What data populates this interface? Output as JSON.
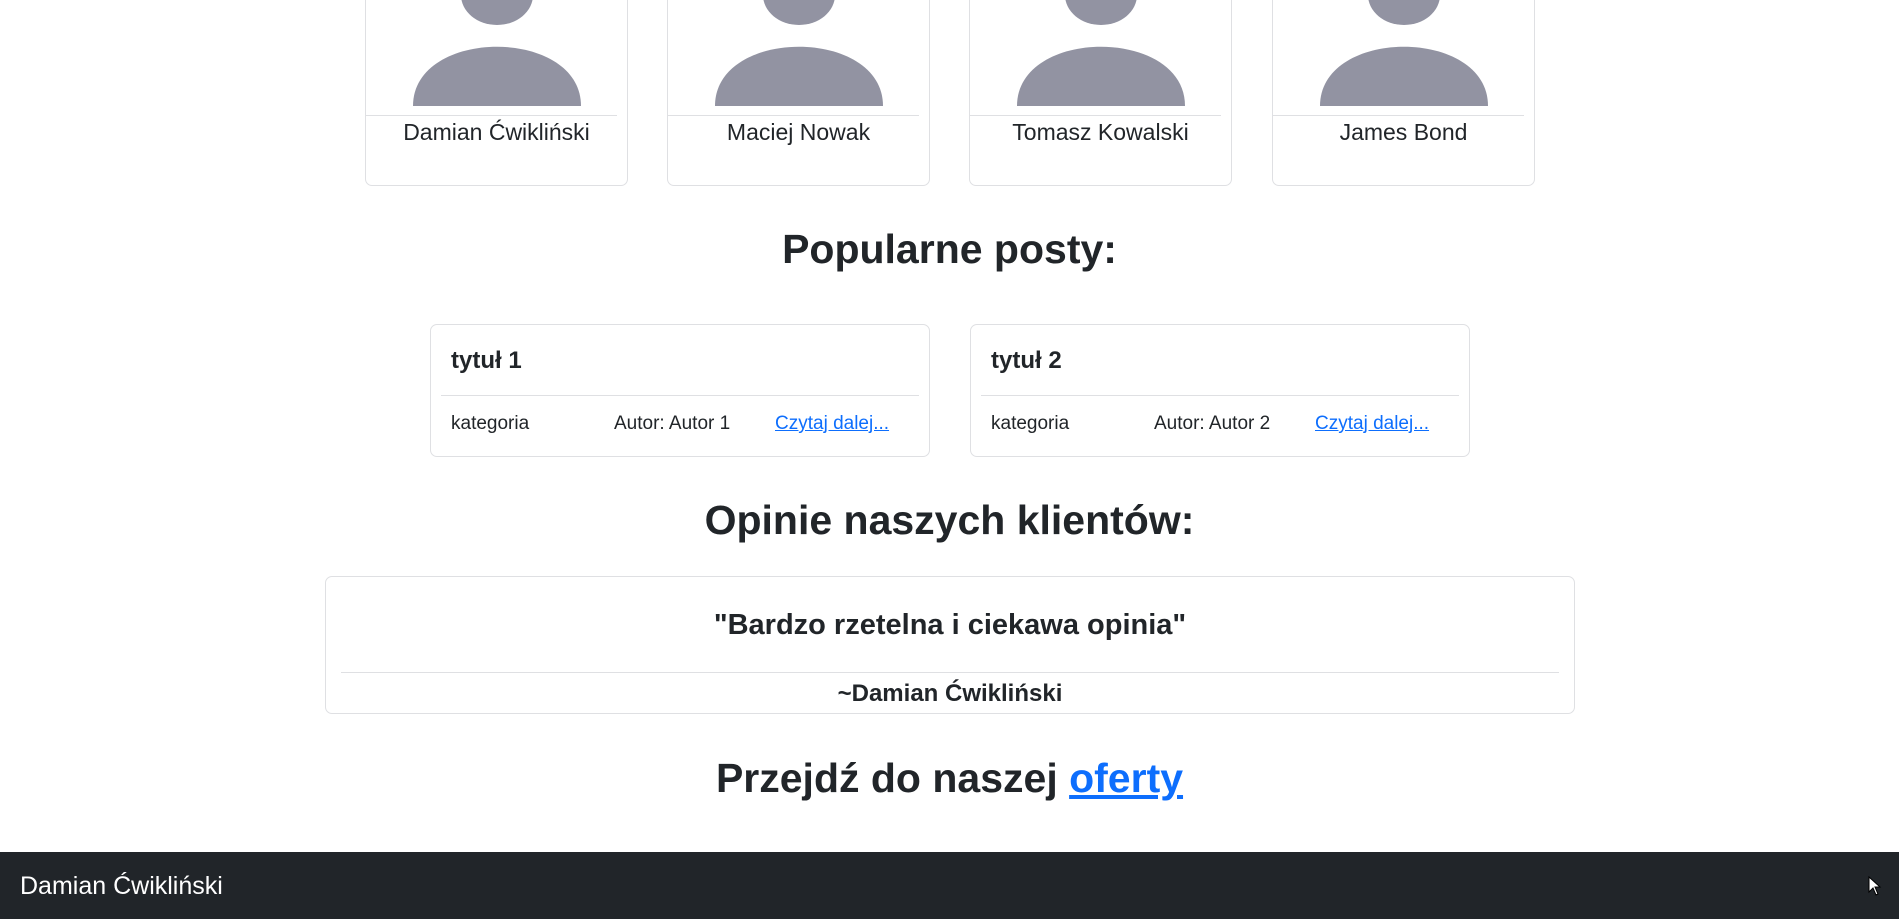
{
  "team": [
    {
      "name": "Damian Ćwikliński",
      "avatar_icon": "person-placeholder-icon"
    },
    {
      "name": "Maciej Nowak",
      "avatar_icon": "person-placeholder-icon"
    },
    {
      "name": "Tomasz Kowalski",
      "avatar_icon": "person-placeholder-icon"
    },
    {
      "name": "James Bond",
      "avatar_icon": "person-placeholder-icon"
    }
  ],
  "posts_section": {
    "title": "Popularne posty:",
    "posts": [
      {
        "title": "tytuł 1",
        "category": "kategoria",
        "author": "Autor: Autor 1",
        "read_more": "Czytaj dalej..."
      },
      {
        "title": "tytuł 2",
        "category": "kategoria",
        "author": "Autor: Autor 2",
        "read_more": "Czytaj dalej..."
      }
    ]
  },
  "reviews_section": {
    "title": "Opinie naszych klientów:",
    "quote": "\"Bardzo rzetelna i ciekawa opinia\"",
    "author": "~Damian Ćwikliński"
  },
  "offer": {
    "prefix": "Przejdź do naszej ",
    "link_text": "oferty"
  },
  "footer": {
    "name": "Damian Ćwikliński"
  },
  "colors": {
    "avatar": "#9293a2",
    "link": "#0d6efd",
    "footer_bg": "#212529",
    "text": "#212529",
    "border": "#dfe0e3"
  }
}
